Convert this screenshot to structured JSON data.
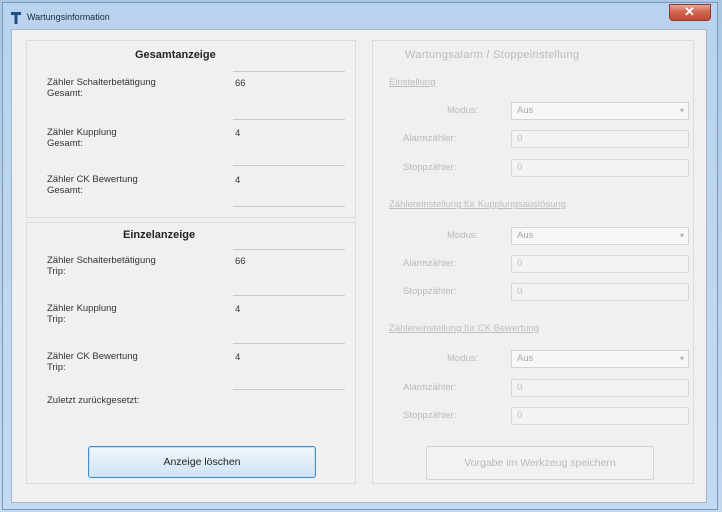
{
  "window": {
    "title": "Wartungsinformation"
  },
  "total_panel": {
    "title": "Gesamtanzeige",
    "rows": [
      {
        "label": "Zähler Schalterbetätigung\nGesamt:",
        "value": "66"
      },
      {
        "label": "Zähler Kupplung\nGesamt:",
        "value": "4"
      },
      {
        "label": "Zähler CK Bewertung\nGesamt:",
        "value": "4"
      }
    ]
  },
  "single_panel": {
    "title": "Einzelanzeige",
    "rows": [
      {
        "label": "Zähler Schalterbetätigung\nTrip:",
        "value": "66"
      },
      {
        "label": "Zähler Kupplung\nTrip:",
        "value": "4"
      },
      {
        "label": "Zähler CK Bewertung\nTrip:",
        "value": "4"
      }
    ],
    "last_reset_label": "Zuletzt zurückgesetzt:",
    "last_reset_value": "",
    "reset_button": "Anzeige löschen"
  },
  "alarm_panel": {
    "title": "Wartungsalarm / Stoppeinstellung",
    "sections": [
      {
        "heading": "Einstellung",
        "mode_label": "Modus:",
        "mode_value": "Aus",
        "alarm_label": "Alarmzähler:",
        "alarm_value": "0",
        "stop_label": "Stoppzähler:",
        "stop_value": "0"
      },
      {
        "heading": "Zählereinstellung für Kupplungsauslösung",
        "mode_label": "Modus:",
        "mode_value": "Aus",
        "alarm_label": "Alarmzähler:",
        "alarm_value": "0",
        "stop_label": "Stoppzähler:",
        "stop_value": "0"
      },
      {
        "heading": "Zählereinstellung für CK Bewertung",
        "mode_label": "Modus:",
        "mode_value": "Aus",
        "alarm_label": "Alarmzähler:",
        "alarm_value": "0",
        "stop_label": "Stoppzähler:",
        "stop_value": "0"
      }
    ],
    "save_button": "Vorgabe im Werkzeug speichern"
  },
  "icons": {
    "app": "tool-icon",
    "close": "close-icon",
    "dropdown": "chevron-down-icon"
  }
}
